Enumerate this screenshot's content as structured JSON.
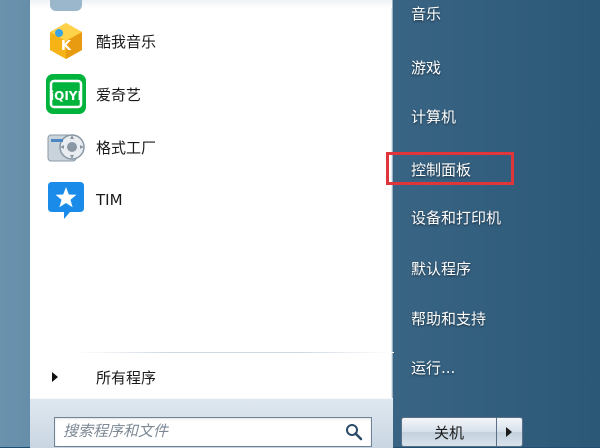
{
  "left_pane": {
    "programs": [
      {
        "label": "酷我音乐",
        "icon": "kuwo-music-icon"
      },
      {
        "label": "爱奇艺",
        "icon": "iqiyi-icon"
      },
      {
        "label": "格式工厂",
        "icon": "format-factory-icon"
      },
      {
        "label": "TIM",
        "icon": "tim-icon"
      }
    ],
    "all_programs_label": "所有程序"
  },
  "search": {
    "placeholder": "搜索程序和文件"
  },
  "right_pane": {
    "items": [
      {
        "label": "音乐"
      },
      {
        "label": "游戏"
      },
      {
        "label": "计算机"
      },
      {
        "label": "控制面板"
      },
      {
        "label": "设备和打印机"
      },
      {
        "label": "默认程序"
      },
      {
        "label": "帮助和支持"
      },
      {
        "label": "运行..."
      }
    ],
    "highlighted_item": "控制面板",
    "highlight_color": "#e0353a"
  },
  "shutdown": {
    "label": "关机"
  },
  "colors": {
    "iqiyi_green": "#00b33c",
    "tim_blue": "#1a8be8",
    "kuwo_yellow": "#f5b316"
  }
}
